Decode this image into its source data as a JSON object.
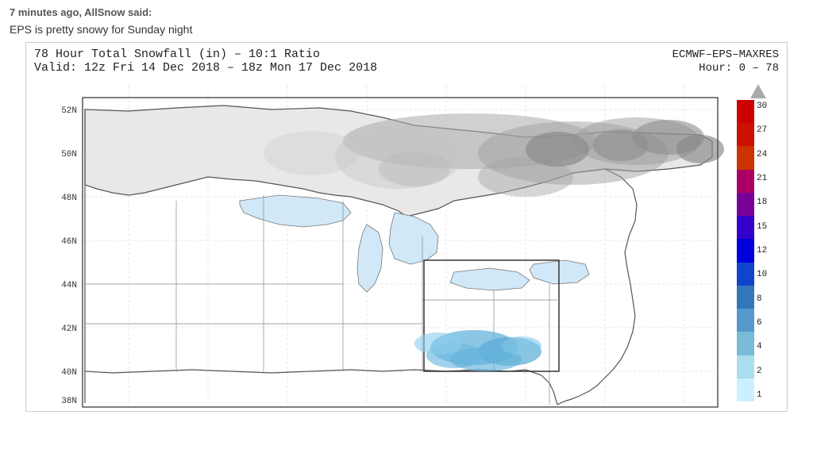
{
  "post": {
    "header": "7 minutes ago, AllSnow said:",
    "description": "EPS is pretty snowy for Sunday night"
  },
  "chart": {
    "title": "78 Hour Total Snowfall (in) – 10:1 Ratio",
    "source": "ECMWF–EPS–MAXRES",
    "valid": "Valid: 12z Fri 14 Dec 2018 – 18z Mon 17 Dec 2018",
    "hour": "Hour: 0 – 78"
  },
  "legend": {
    "values": [
      "30",
      "27",
      "24",
      "21",
      "18",
      "15",
      "12",
      "10",
      "8",
      "6",
      "4",
      "2",
      "1"
    ],
    "colors": [
      "#cc0000",
      "#dd2200",
      "#ee4400",
      "#bb0055",
      "#880099",
      "#4400cc",
      "#0000ee",
      "#2255dd",
      "#4499cc",
      "#66bbdd",
      "#88ddee",
      "#aaeeff",
      "#ccf0ff"
    ]
  }
}
